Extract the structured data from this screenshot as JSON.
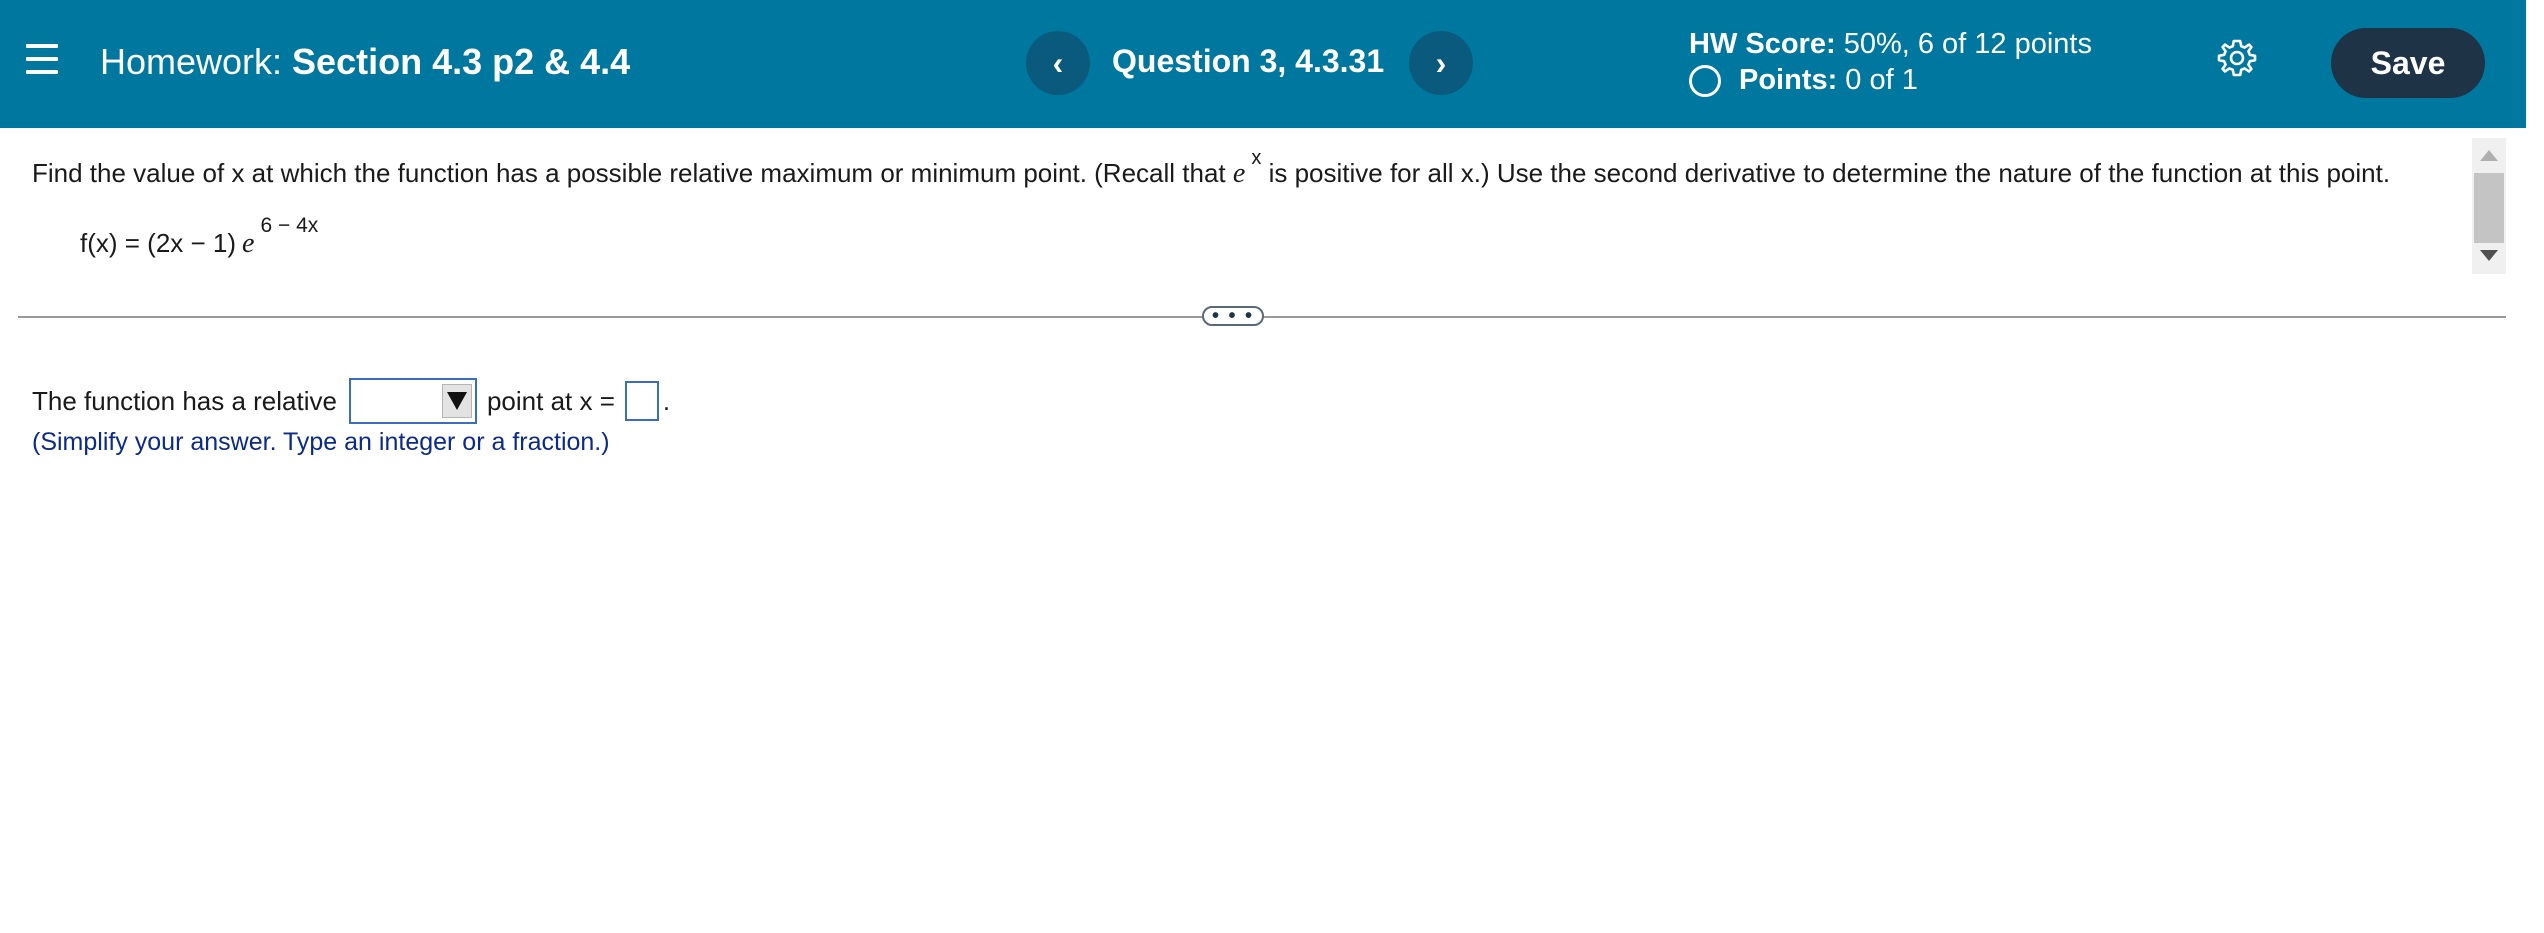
{
  "header": {
    "homework_prefix": "Homework:",
    "homework_name": "Section 4.3 p2 & 4.4",
    "question_label": "Question 3, 4.3.31",
    "prev_icon": "chevron-left-icon",
    "next_icon": "chevron-right-icon",
    "prev_glyph": "‹",
    "next_glyph": "›",
    "hw_score_label": "HW Score:",
    "hw_score_value": "50%, 6 of 12 points",
    "points_label": "Points:",
    "points_value": "0 of 1",
    "save_label": "Save",
    "menu_icon": "hamburger-menu-icon",
    "settings_icon": "gear-icon"
  },
  "question": {
    "text_before": "Find the value of x at which the function has a possible relative maximum or minimum point. (Recall that",
    "e_symbol": "e",
    "e_exponent": "x",
    "text_after": "is positive for all x.) Use the second derivative to determine the nature of the function at this point.",
    "function_prefix": "f(x) = (2x − 1)",
    "function_e": "e",
    "function_exponent": "6 − 4x"
  },
  "divider": {
    "handle_label": "• • •"
  },
  "answer": {
    "text_before": "The function has a relative",
    "dropdown_value": "",
    "text_middle": "point at x =",
    "input_value": "",
    "period": ".",
    "hint": "(Simplify your answer. Type an integer or a fraction.)"
  },
  "colors": {
    "header_bg": "#00779e",
    "nav_button_bg": "#0a5a7d",
    "save_button_bg": "#1e3346",
    "input_border": "#3b6cc0",
    "hint_text": "#0b2a8a"
  }
}
